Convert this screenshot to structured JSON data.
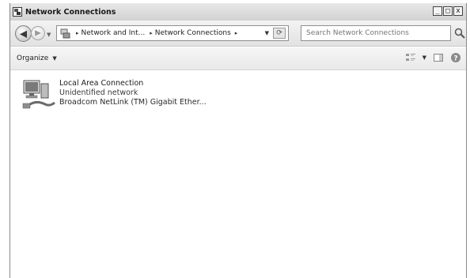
{
  "window": {
    "title": "Network Connections",
    "controls": {
      "minimize": "_",
      "maximize": "□",
      "close": "x"
    }
  },
  "address_bar": {
    "breadcrumb": [
      "Network and Int...",
      "Network Connections"
    ],
    "search_placeholder": "Search Network Connections"
  },
  "command_bar": {
    "organize_label": "Organize",
    "icons": [
      "change-view-icon",
      "more-options-icon",
      "preview-pane-icon",
      "help-icon"
    ]
  },
  "connections": [
    {
      "name": "Local Area Connection",
      "status": "Unidentified network",
      "device": "Broadcom NetLink (TM) Gigabit Ether..."
    }
  ]
}
